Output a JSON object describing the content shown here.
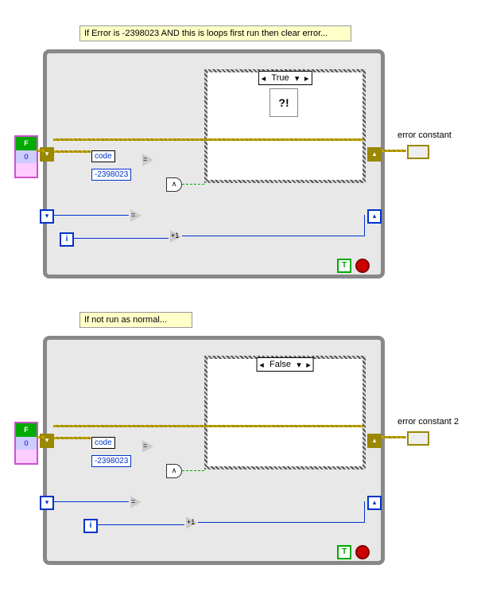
{
  "comments": {
    "top": "If Error is -2398023 AND this is loops first run then clear error...",
    "bottom": "If not run as normal..."
  },
  "diagram1": {
    "case_value": "True",
    "code_label": "code",
    "error_code": "-2398023",
    "bool_const": "T",
    "iter_label": "i",
    "false_label": "F",
    "zero_label": "0",
    "indicator_label": "error constant"
  },
  "diagram2": {
    "case_value": "False",
    "code_label": "code",
    "error_code": "-2398023",
    "bool_const": "T",
    "iter_label": "i",
    "false_label": "F",
    "zero_label": "0",
    "indicator_label": "error constant 2"
  }
}
